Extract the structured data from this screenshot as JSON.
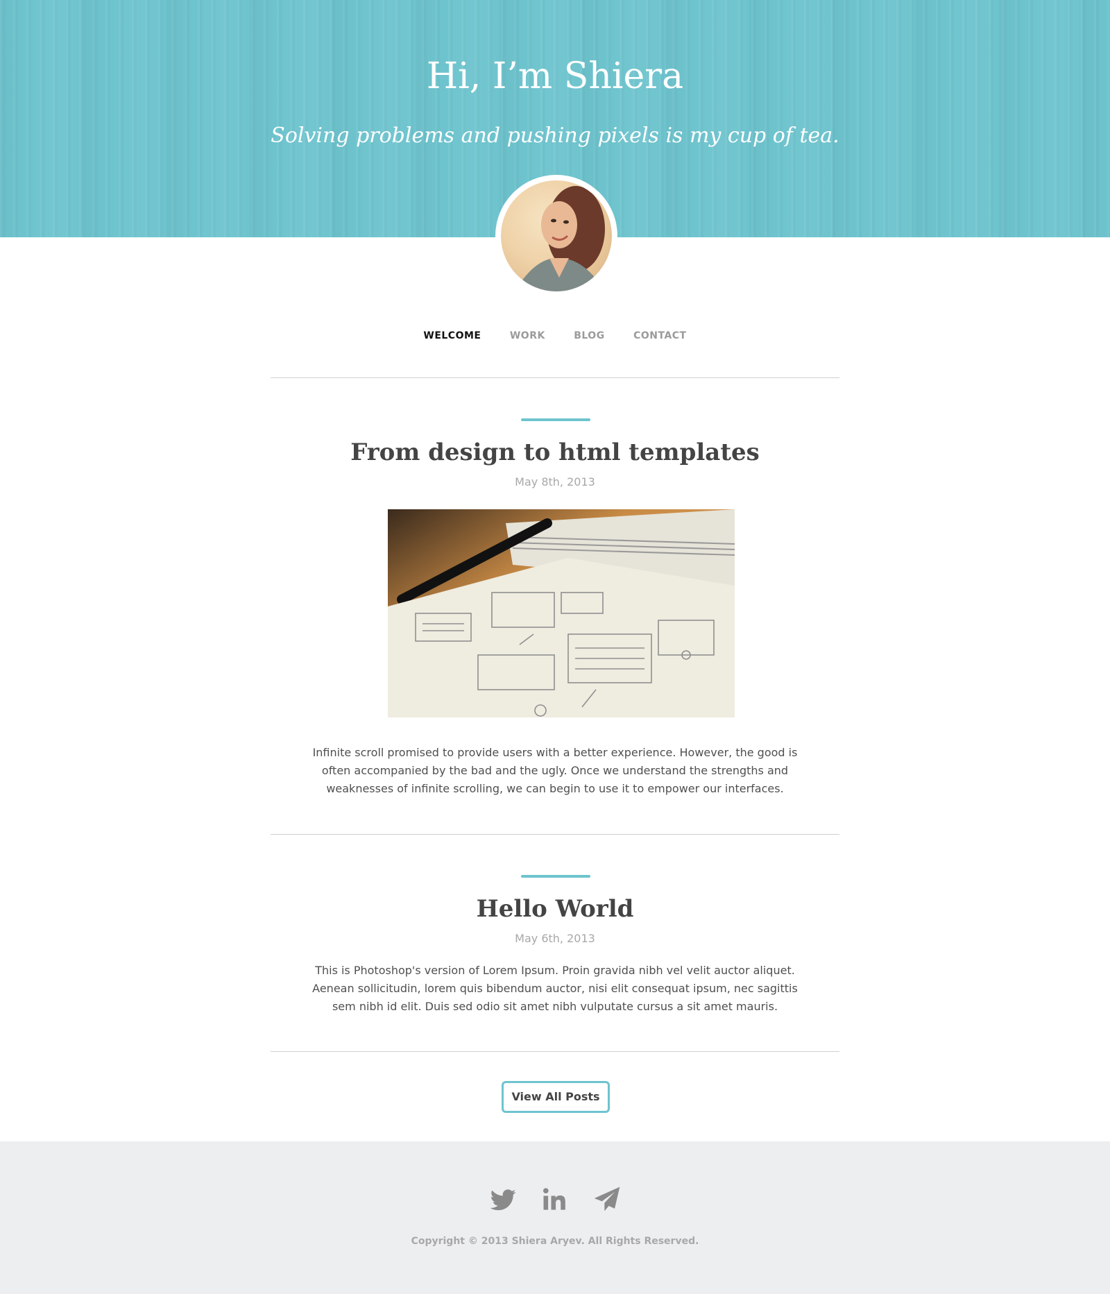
{
  "hero": {
    "title": "Hi, I’m Shiera",
    "tagline": "Solving problems and pushing pixels is my cup of tea."
  },
  "nav": {
    "items": [
      {
        "label": "WELCOME",
        "active": true
      },
      {
        "label": "WORK",
        "active": false
      },
      {
        "label": "BLOG",
        "active": false
      },
      {
        "label": "CONTACT",
        "active": false
      }
    ]
  },
  "posts": [
    {
      "title": "From design to html templates",
      "date": "May 8th, 2013",
      "body": "Infinite scroll promised to provide users with a better experience. However, the good is often accompanied by the bad and the ugly. Once we understand the strengths and weaknesses of infinite scrolling, we can begin to use it to empower our interfaces."
    },
    {
      "title": "Hello World",
      "date": "May 6th, 2013",
      "body": "This is Photoshop's version  of Lorem Ipsum. Proin gravida nibh vel velit auctor aliquet. Aenean sollicitudin, lorem quis bibendum auctor, nisi elit consequat ipsum, nec sagittis sem nibh id elit. Duis sed odio sit amet nibh vulputate cursus a sit amet mauris."
    }
  ],
  "view_all_label": "View All Posts",
  "footer": {
    "social": [
      "twitter-icon",
      "linkedin-icon",
      "paper-plane-icon"
    ],
    "copyright": "Copyright © 2013 Shiera Aryev. All Rights Reserved."
  },
  "colors": {
    "accent": "#6ec4ce",
    "footer_bg": "#edeef0",
    "text": "#4a4a4a"
  }
}
